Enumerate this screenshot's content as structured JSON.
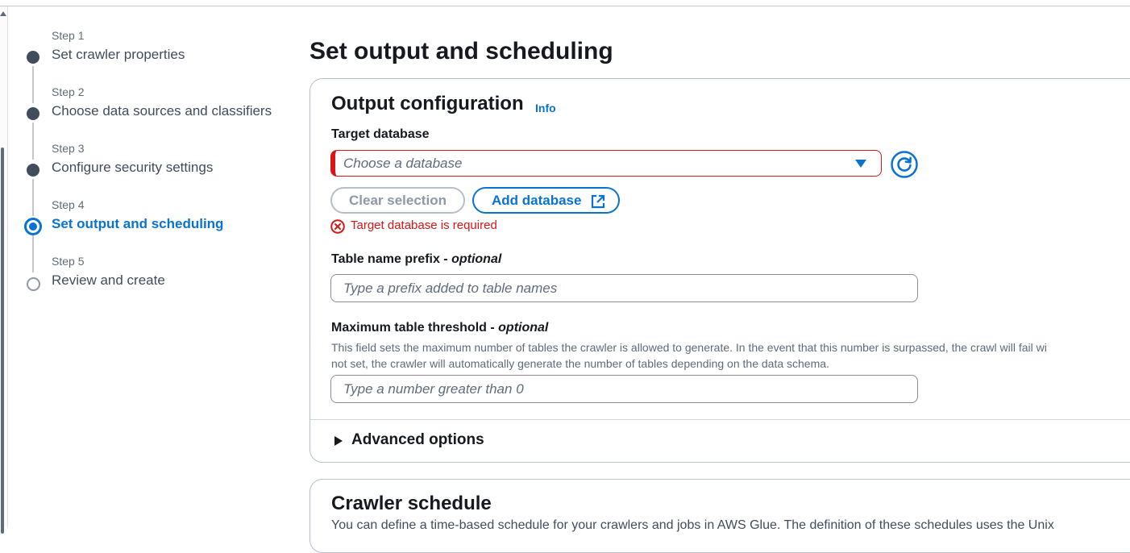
{
  "steps": [
    {
      "num": "Step 1",
      "title": "Set crawler properties",
      "state": "complete"
    },
    {
      "num": "Step 2",
      "title": "Choose data sources and classifiers",
      "state": "complete"
    },
    {
      "num": "Step 3",
      "title": "Configure security settings",
      "state": "complete"
    },
    {
      "num": "Step 4",
      "title": "Set output and scheduling",
      "state": "active"
    },
    {
      "num": "Step 5",
      "title": "Review and create",
      "state": "pending"
    }
  ],
  "page_title": "Set output and scheduling",
  "output_config": {
    "heading": "Output configuration",
    "info_link": "Info",
    "target_db": {
      "label": "Target database",
      "placeholder": "Choose a database",
      "clear_label": "Clear selection",
      "add_label": "Add database",
      "error": "Target database is required"
    },
    "prefix": {
      "label": "Table name prefix - ",
      "optional": "optional",
      "placeholder": "Type a prefix added to table names"
    },
    "threshold": {
      "label": "Maximum table threshold - ",
      "optional": "optional",
      "desc_line1": "This field sets the maximum number of tables the crawler is allowed to generate. In the event that this number is surpassed, the crawl will fail wi",
      "desc_line2": "not set, the crawler will automatically generate the number of tables depending on the data schema.",
      "placeholder": "Type a number greater than 0"
    },
    "advanced": "Advanced options"
  },
  "crawler_schedule": {
    "heading": "Crawler schedule",
    "desc": "You can define a time-based schedule for your crawlers and jobs in AWS Glue. The definition of these schedules uses the Unix"
  },
  "colors": {
    "accent": "#0972d3",
    "error": "#d91515",
    "text": "#16191f",
    "muted": "#5f6b7a"
  }
}
